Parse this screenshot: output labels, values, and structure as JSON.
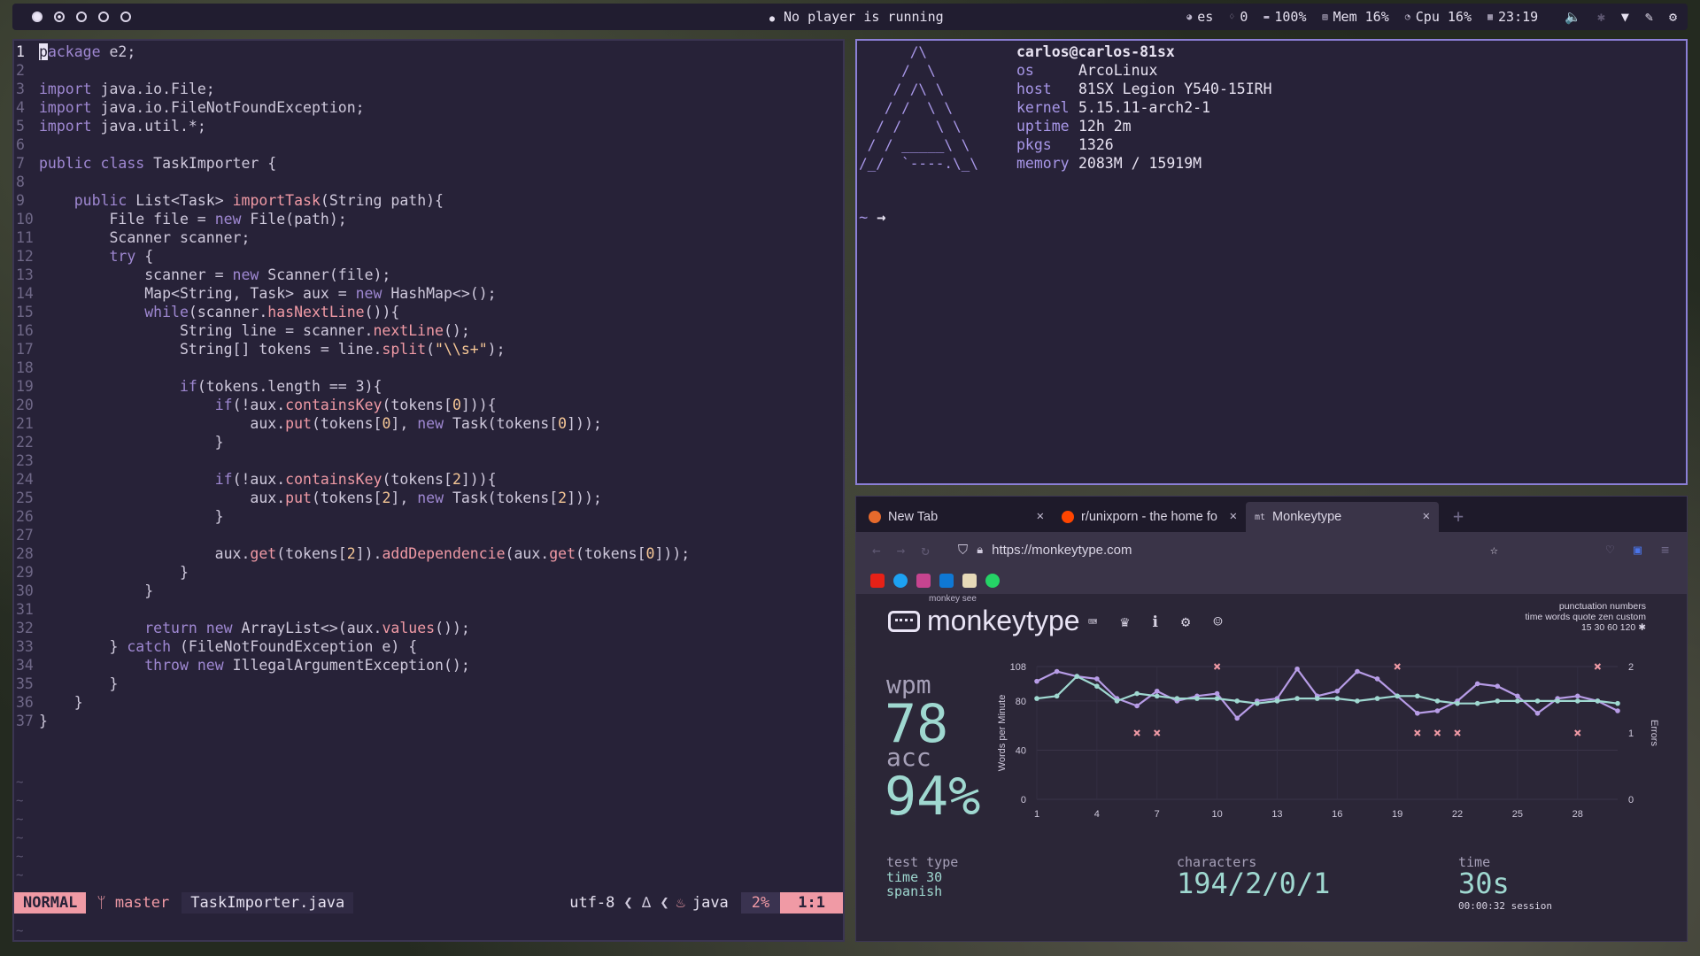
{
  "topbar": {
    "player": "No player is running",
    "lang": "es",
    "updates": "0",
    "battery": "100%",
    "mem": "Mem 16%",
    "cpu": "Cpu 16%",
    "time": "23:19",
    "volume_icon": "speaker-icon",
    "bluetooth_icon": "bluetooth-icon",
    "wifi_icon": "wifi-icon"
  },
  "editor": {
    "lines": [
      "package e2;",
      "",
      "import java.io.File;",
      "import java.io.FileNotFoundException;",
      "import java.util.*;",
      "",
      "public class TaskImporter {",
      "",
      "    public List<Task> importTask(String path){",
      "        File file = new File(path);",
      "        Scanner scanner;",
      "        try {",
      "            scanner = new Scanner(file);",
      "            Map<String, Task> aux = new HashMap<>();",
      "            while(scanner.hasNextLine()){",
      "                String line = scanner.nextLine();",
      "                String[] tokens = line.split(\"\\\\s+\");",
      "",
      "                if(tokens.length == 3){",
      "                    if(!aux.containsKey(tokens[0])){",
      "                        aux.put(tokens[0], new Task(tokens[0]));",
      "                    }",
      "",
      "                    if(!aux.containsKey(tokens[2])){",
      "                        aux.put(tokens[2], new Task(tokens[2]));",
      "                    }",
      "",
      "                    aux.get(tokens[2]).addDependencie(aux.get(tokens[0]));",
      "                }",
      "            }",
      "",
      "            return new ArrayList<>(aux.values());",
      "        } catch (FileNotFoundException e) {",
      "            throw new IllegalArgumentException();",
      "        }",
      "    }",
      "}"
    ],
    "status": {
      "mode": "NORMAL",
      "branch": "master",
      "file": "TaskImporter.java",
      "encoding": "utf-8",
      "filetype": "java",
      "percent": "2%",
      "position": "1:1"
    }
  },
  "terminal": {
    "title": "carlos@carlos-81sx",
    "info": [
      {
        "k": "os",
        "v": "ArcoLinux"
      },
      {
        "k": "host",
        "v": "81SX Legion Y540-15IRH"
      },
      {
        "k": "kernel",
        "v": "5.15.11-arch2-1"
      },
      {
        "k": "uptime",
        "v": "12h 2m"
      },
      {
        "k": "pkgs",
        "v": "1326"
      },
      {
        "k": "memory",
        "v": "2083M / 15919M"
      }
    ],
    "prompt": "~",
    "arrow": "→"
  },
  "browser": {
    "tabs": [
      {
        "label": "New Tab",
        "color": "#e66a2c"
      },
      {
        "label": "r/unixporn - the home fo",
        "color": "#ff4500"
      },
      {
        "label": "Monkeytype",
        "color": "#e2b714"
      }
    ],
    "url": "https://monkeytype.com",
    "monkeytype": {
      "name": "monkeytype",
      "sub": "monkey see",
      "config_line1": "punctuation numbers",
      "config_line2": "time words quote zen custom",
      "config_line3": "15 30 60 120",
      "wpm_label": "wpm",
      "wpm": "78",
      "acc_label": "acc",
      "acc": "94%",
      "test_type_label": "test type",
      "test_type_1": "time 30",
      "test_type_2": "spanish",
      "characters_label": "characters",
      "characters": "194/2/0/1",
      "time_label": "time",
      "time": "30s",
      "session": "00:00:32 session"
    }
  },
  "chart_data": {
    "type": "line",
    "x": [
      1,
      2,
      3,
      4,
      5,
      6,
      7,
      8,
      9,
      10,
      11,
      12,
      13,
      14,
      15,
      16,
      17,
      18,
      19,
      20,
      21,
      22,
      23,
      24,
      25,
      26,
      27,
      28,
      29,
      30
    ],
    "series": [
      {
        "name": "",
        "values": [
          96,
          104,
          100,
          98,
          82,
          76,
          88,
          80,
          84,
          86,
          66,
          80,
          82,
          106,
          84,
          88,
          104,
          98,
          84,
          70,
          72,
          80,
          94,
          92,
          84,
          70,
          82,
          84,
          80,
          72
        ]
      },
      {
        "name": "",
        "values": [
          82,
          84,
          100,
          92,
          80,
          86,
          84,
          82,
          82,
          82,
          80,
          78,
          80,
          82,
          82,
          82,
          80,
          82,
          84,
          84,
          80,
          78,
          78,
          80,
          80,
          80,
          80,
          80,
          80,
          78
        ]
      }
    ],
    "errors_x": [
      6,
      7,
      10,
      19,
      20,
      21,
      22,
      28,
      29
    ],
    "errors_y": [
      1,
      1,
      2,
      2,
      1,
      1,
      1,
      1,
      2
    ],
    "ylabel": "Words per Minute",
    "y2label": "Errors",
    "ylim": [
      0,
      108
    ],
    "y2lim": [
      0,
      2
    ],
    "yticks": [
      0,
      40,
      80,
      108
    ],
    "xticks": [
      1,
      4,
      7,
      10,
      13,
      16,
      19,
      22,
      25,
      28
    ],
    "colors": {
      "raw": "#b79ce6",
      "wpm": "#9fd8d0",
      "errors": "#f09aa5"
    }
  }
}
